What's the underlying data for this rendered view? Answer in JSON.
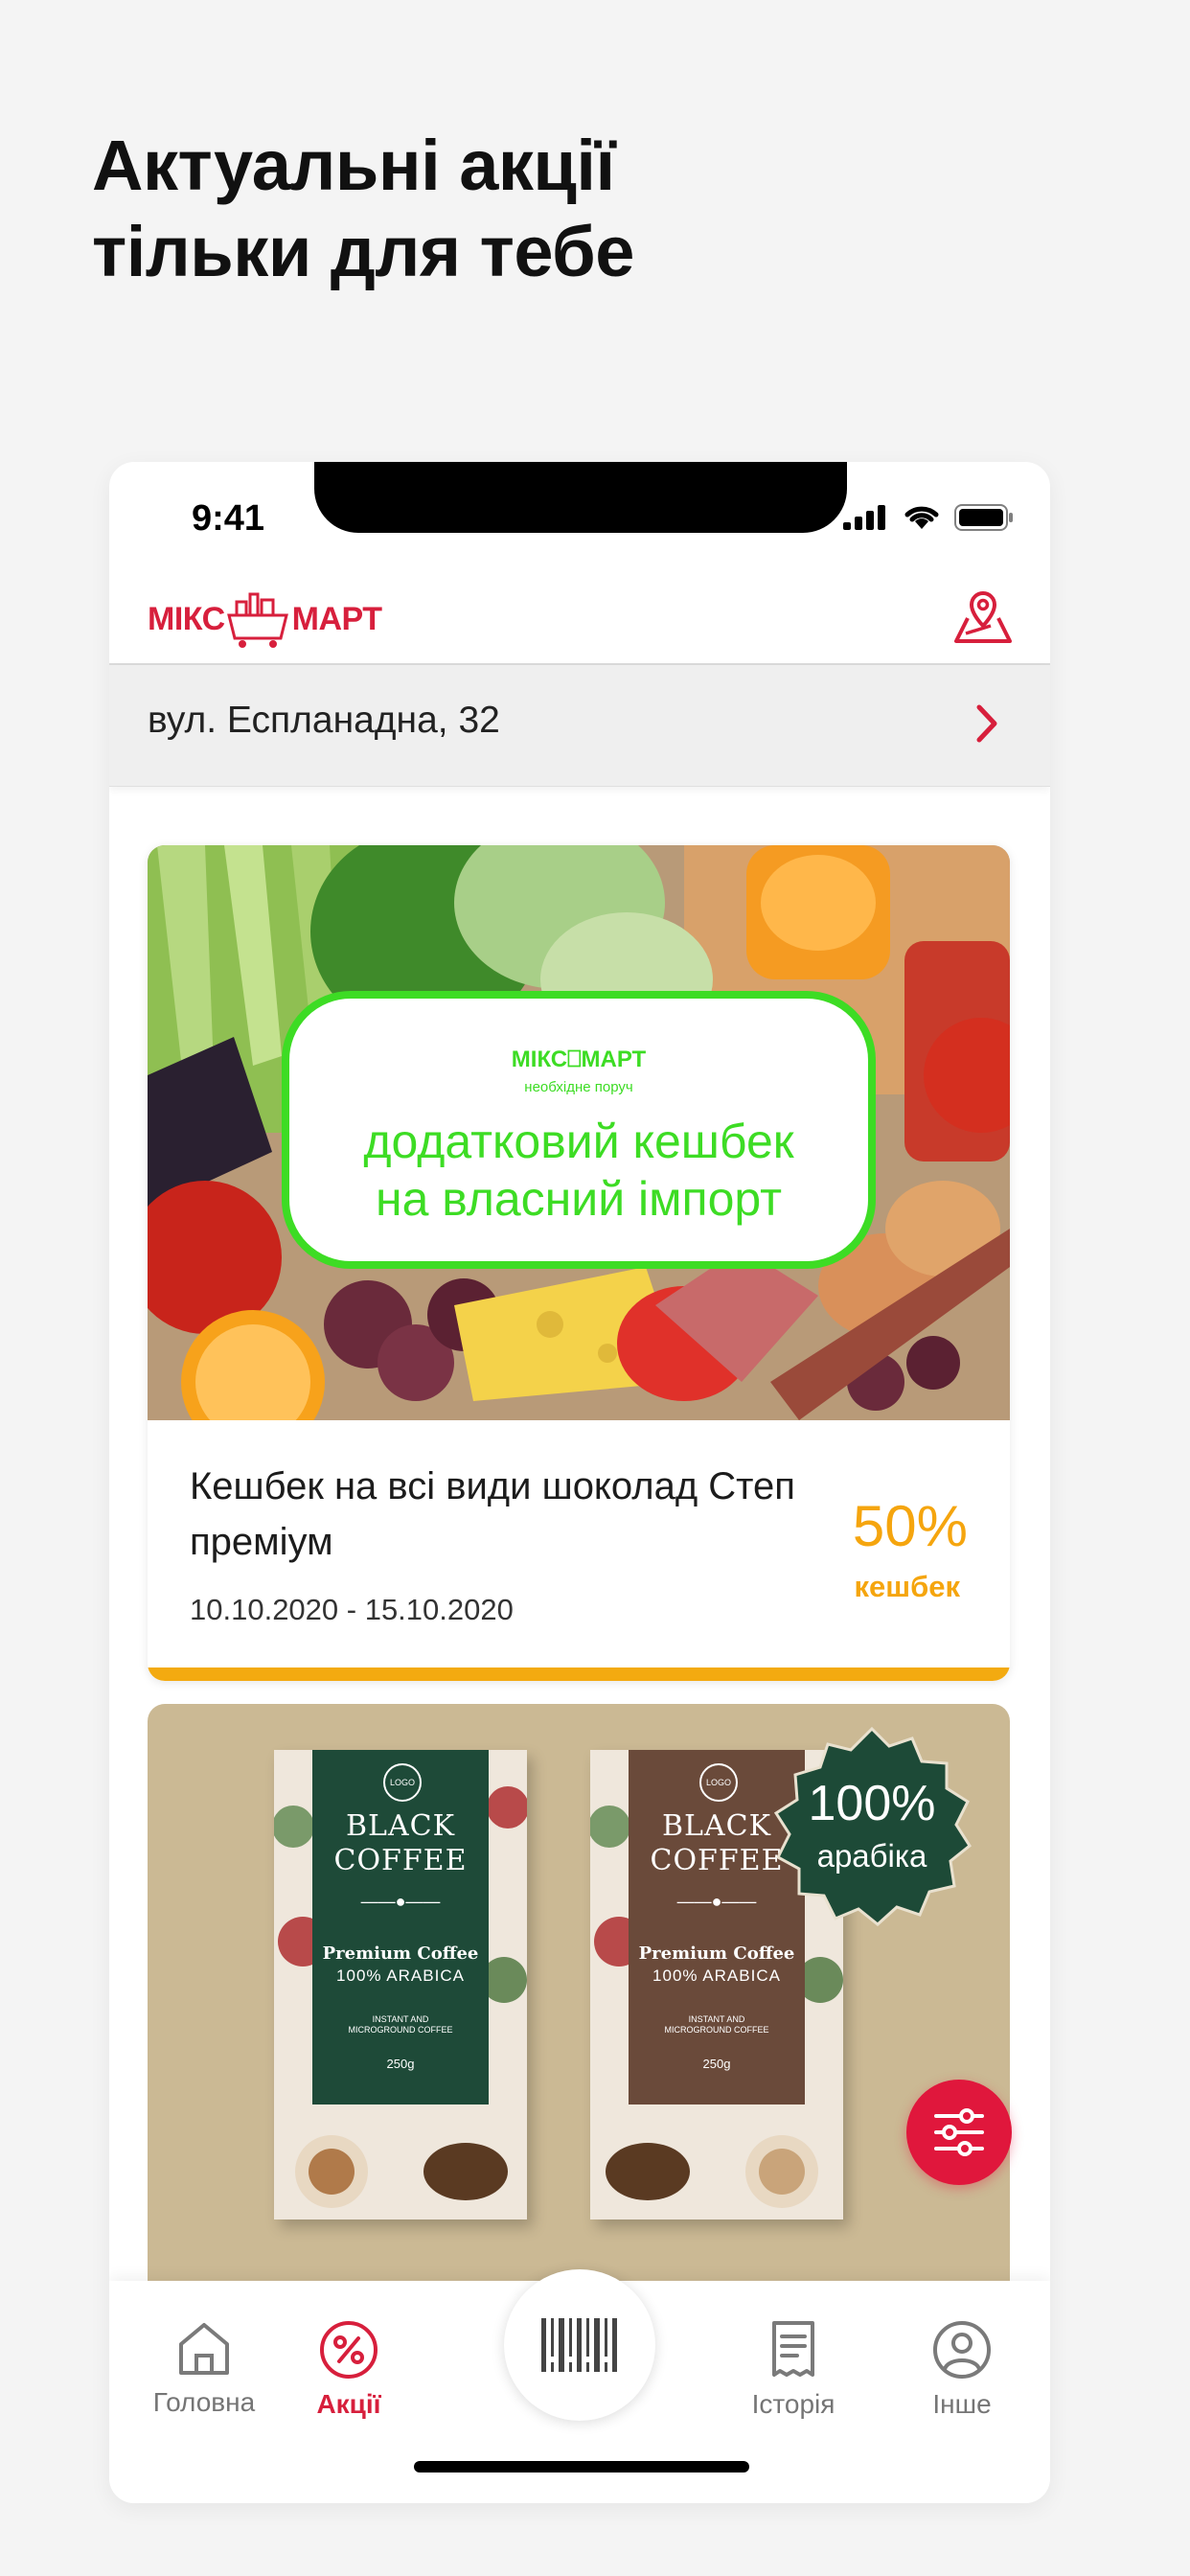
{
  "headline": {
    "line1": "Актуальні акції",
    "line2": "тільки для тебе"
  },
  "statusbar": {
    "time": "9:41"
  },
  "brand": {
    "name_left": "МІКС",
    "name_right": "МАРТ",
    "tagline": "необхідне поруч",
    "color": "#d71f3c"
  },
  "address": {
    "text": "вул. Еспланадна, 32"
  },
  "promo_card": {
    "banner_line1": "додатковий кешбек",
    "banner_line2": "на власний імпорт",
    "banner_color": "#3ddc24",
    "title": "Кешбек на всі види шоколад Степ преміум",
    "dates": "10.10.2020 - 15.10.2020",
    "percent": "50%",
    "percent_label": "кешбек",
    "accent": "#f5a50e"
  },
  "coffee_card": {
    "pack_logo": "LOGO",
    "pack_title_line1": "BLACK",
    "pack_title_line2": "COFFEE",
    "pack_premium": "Premium Coffee",
    "pack_arabica": "100% ARABICA",
    "pack_instant_line1": "INSTANT AND",
    "pack_instant_line2": "MICROGROUND COFFEE",
    "pack_weight": "250g",
    "seal_line1": "100%",
    "seal_line2": "арабіка"
  },
  "tabbar": {
    "items": [
      {
        "label": "Головна",
        "icon": "home-icon"
      },
      {
        "label": "Акції",
        "icon": "percent-icon"
      },
      {
        "label": "",
        "icon": "barcode-icon"
      },
      {
        "label": "Історія",
        "icon": "receipt-icon"
      },
      {
        "label": "Інше",
        "icon": "profile-icon"
      }
    ],
    "active_index": 1
  }
}
